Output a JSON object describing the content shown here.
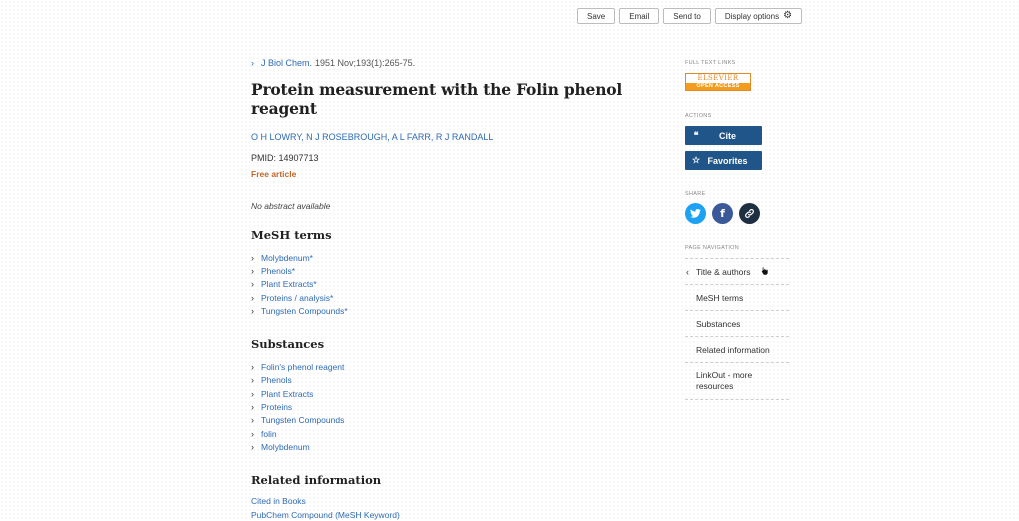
{
  "toolbar": {
    "save": "Save",
    "email": "Email",
    "send_to": "Send to",
    "display_options": "Display options"
  },
  "article": {
    "journal": "J Biol Chem.",
    "citation": "1951 Nov;193(1):265-75.",
    "title": "Protein measurement with the Folin phenol reagent",
    "authors": "O H LOWRY, N J ROSEBROUGH, A L FARR, R J RANDALL",
    "pmid": "PMID: 14907713",
    "free": "Free article",
    "abstract": "No abstract available"
  },
  "mesh": {
    "title": "MeSH terms",
    "items": [
      "Molybdenum*",
      "Phenols*",
      "Plant Extracts*",
      "Proteins / analysis*",
      "Tungsten Compounds*"
    ]
  },
  "substances": {
    "title": "Substances",
    "items": [
      "Folin's phenol reagent",
      "Phenols",
      "Plant Extracts",
      "Proteins",
      "Tungsten Compounds",
      "folin",
      "Molybdenum"
    ]
  },
  "related": {
    "title": "Related information",
    "items": [
      "Cited in Books",
      "PubChem Compound (MeSH Keyword)"
    ]
  },
  "sidebar": {
    "full_text_label": "FULL TEXT LINKS",
    "elsevier_top": "ELSEVIER",
    "elsevier_bottom": "OPEN ACCESS",
    "actions_label": "ACTIONS",
    "cite": "Cite",
    "favorites": "Favorites",
    "share_label": "SHARE",
    "page_nav_label": "PAGE NAVIGATION",
    "nav": [
      "Title & authors",
      "MeSH terms",
      "Substances",
      "Related information",
      "LinkOut - more resources"
    ]
  }
}
